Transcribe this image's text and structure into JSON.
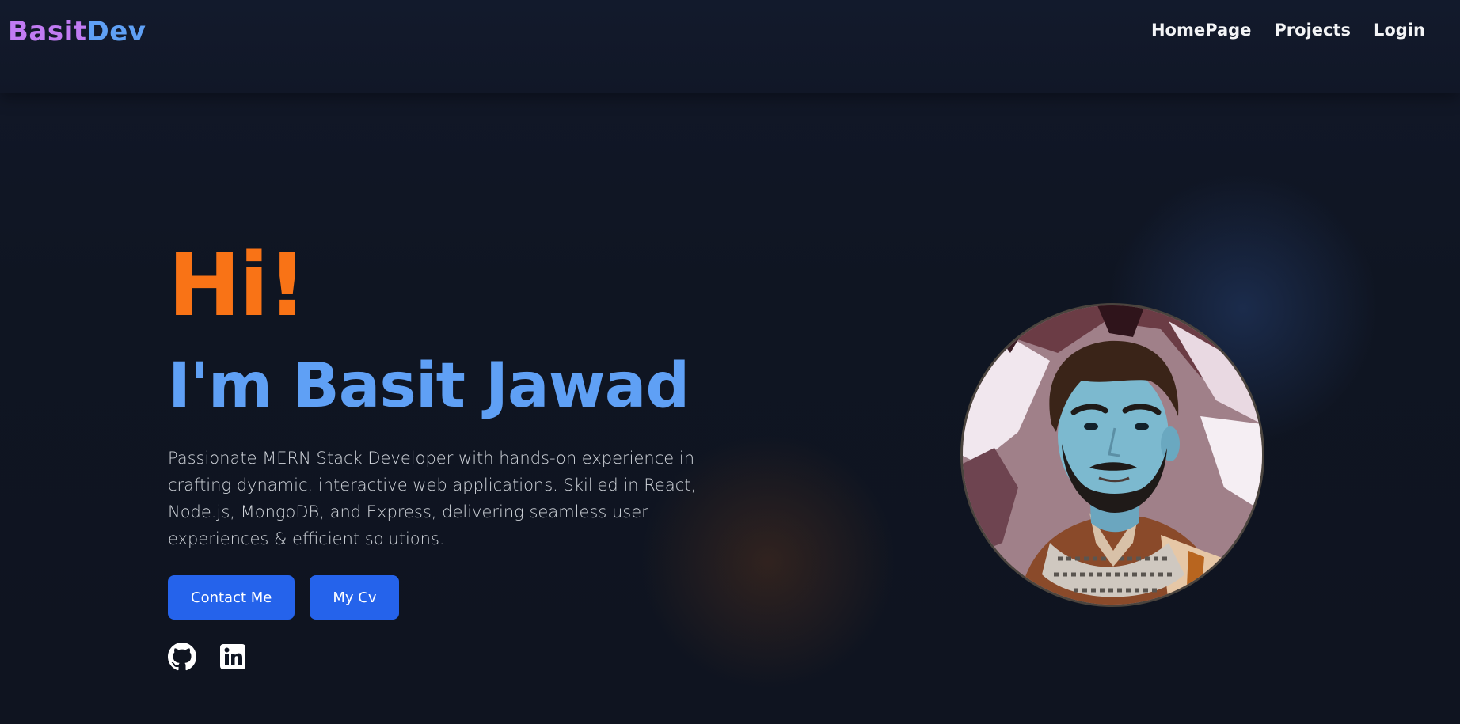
{
  "header": {
    "logo_part1": "Basit",
    "logo_part2": "Dev",
    "nav": [
      {
        "label": "HomePage"
      },
      {
        "label": "Projects"
      },
      {
        "label": "Login"
      }
    ]
  },
  "hero": {
    "greeting": "Hi!",
    "name": "I'm Basit Jawad",
    "bio": "Passionate MERN Stack Developer with hands-on experience in crafting dynamic, interactive web applications. Skilled in React, Node.js, MongoDB, and Express, delivering seamless user experiences & efficient solutions.",
    "buttons": {
      "contact": "Contact Me",
      "cv": "My Cv"
    },
    "social_icons": [
      "github-icon",
      "linkedin-icon"
    ]
  },
  "colors": {
    "accent_orange": "#f97316",
    "accent_blue": "#5fa0f5",
    "logo_purple": "#c17bf3",
    "button_blue": "#2563eb",
    "background": "#0f1523"
  }
}
